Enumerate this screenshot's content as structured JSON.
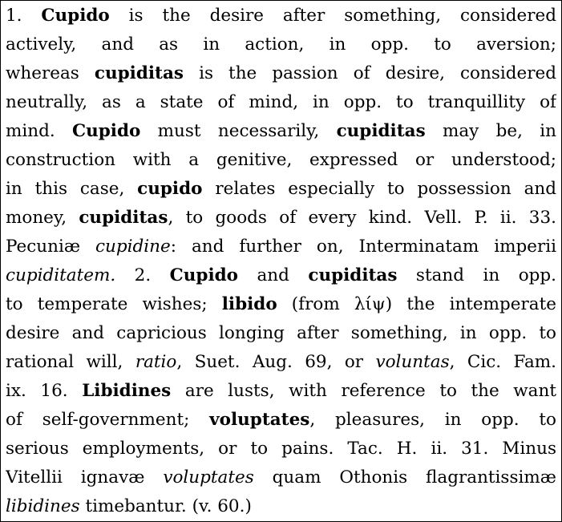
{
  "lines": [
    [
      {
        "t": "1.  ",
        "s": ""
      },
      {
        "t": "Cupido",
        "s": "b"
      },
      {
        "t": " is the desire after something, considered",
        "s": ""
      }
    ],
    [
      {
        "t": "actively, and as in action, in opp.  to aversion;",
        "s": ""
      }
    ],
    [
      {
        "t": "whereas ",
        "s": ""
      },
      {
        "t": "cupiditas",
        "s": "b"
      },
      {
        "t": " is the passion of desire, considered",
        "s": ""
      }
    ],
    [
      {
        "t": "neutrally, as a state of mind, in opp.  to tranquillity of",
        "s": ""
      }
    ],
    [
      {
        "t": "mind.  ",
        "s": ""
      },
      {
        "t": "Cupido",
        "s": "b"
      },
      {
        "t": " must necessarily, ",
        "s": ""
      },
      {
        "t": "cupiditas",
        "s": "b"
      },
      {
        "t": " may be, in",
        "s": ""
      }
    ],
    [
      {
        "t": "construction with a genitive, expressed or understood;",
        "s": ""
      }
    ],
    [
      {
        "t": "in this case, ",
        "s": ""
      },
      {
        "t": "cupido",
        "s": "b"
      },
      {
        "t": " relates especially to possession and",
        "s": ""
      }
    ],
    [
      {
        "t": "money, ",
        "s": ""
      },
      {
        "t": "cupiditas",
        "s": "b"
      },
      {
        "t": ", to goods of every kind. Vell. P. ii. 33.",
        "s": ""
      }
    ],
    [
      {
        "t": "Pecuniæ ",
        "s": ""
      },
      {
        "t": "cupidine",
        "s": "i"
      },
      {
        "t": ": and further on, Interminatam imperii",
        "s": ""
      }
    ],
    [
      {
        "t": "cupiditatem.",
        "s": "i"
      },
      {
        "t": "  2.  ",
        "s": ""
      },
      {
        "t": "Cupido",
        "s": "b"
      },
      {
        "t": " and ",
        "s": ""
      },
      {
        "t": "cupiditas",
        "s": "b"
      },
      {
        "t": " stand in opp.",
        "s": ""
      }
    ],
    [
      {
        "t": "to temperate wishes; ",
        "s": ""
      },
      {
        "t": "libido",
        "s": "b"
      },
      {
        "t": " (from λίψ) the intemperate",
        "s": ""
      }
    ],
    [
      {
        "t": "desire and capricious longing after something, in opp.  to",
        "s": ""
      }
    ],
    [
      {
        "t": "rational will, ",
        "s": ""
      },
      {
        "t": "ratio",
        "s": "i"
      },
      {
        "t": ", Suet.  Aug.  69, or ",
        "s": ""
      },
      {
        "t": "voluntas",
        "s": "i"
      },
      {
        "t": ", Cic.  Fam.",
        "s": ""
      }
    ],
    [
      {
        "t": "ix.  16.  ",
        "s": ""
      },
      {
        "t": "Libidines",
        "s": "b"
      },
      {
        "t": " are lusts, with reference to the want",
        "s": ""
      }
    ],
    [
      {
        "t": "of self-government; ",
        "s": ""
      },
      {
        "t": "voluptates",
        "s": "b"
      },
      {
        "t": ", pleasures, in opp.  to",
        "s": ""
      }
    ],
    [
      {
        "t": "serious employments, or to pains.  Tac.  H. ii.  31.  Minus",
        "s": ""
      }
    ],
    [
      {
        "t": "Vitellii ignavæ ",
        "s": ""
      },
      {
        "t": "voluptates",
        "s": "i"
      },
      {
        "t": " quam Othonis flagrantissimæ",
        "s": ""
      }
    ],
    [
      {
        "t": "libidines",
        "s": "i"
      },
      {
        "t": " timebantur.  (v. 60.)",
        "s": ""
      }
    ]
  ]
}
